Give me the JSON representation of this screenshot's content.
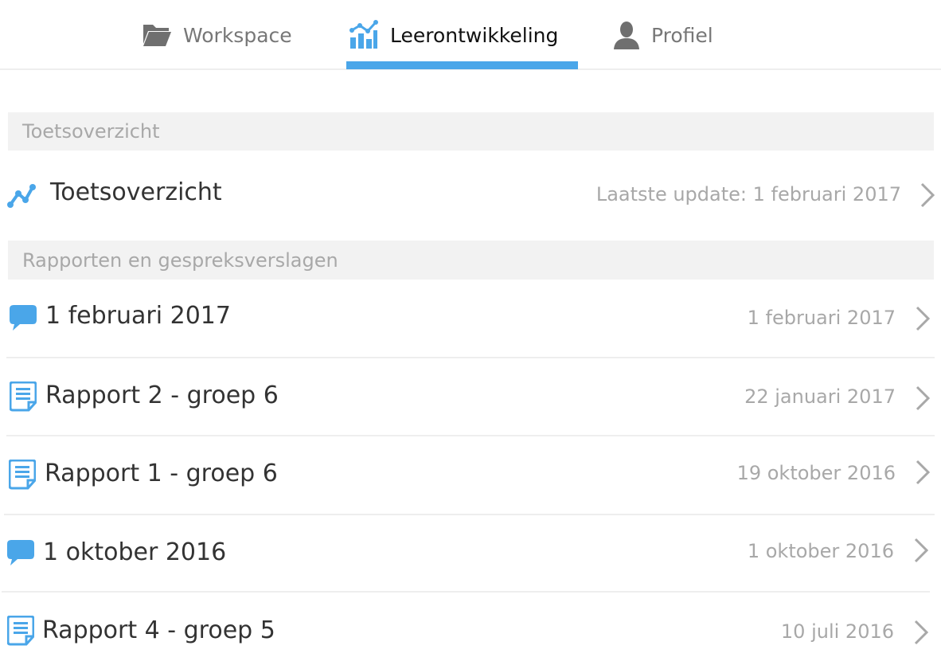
{
  "tabs": [
    {
      "label": "Workspace",
      "icon": "folder-icon",
      "active": false
    },
    {
      "label": "Leerontwikkeling",
      "icon": "chart-icon",
      "active": true
    },
    {
      "label": "Profiel",
      "icon": "user-icon",
      "active": false
    }
  ],
  "sections": [
    {
      "header": "Toetsoverzicht",
      "items": [
        {
          "title": "Toetsoverzicht",
          "date": "Laatste update: 1 februari 2017",
          "icon": "line-chart-icon"
        }
      ]
    },
    {
      "header": "Rapporten en gespreksverslagen",
      "items": [
        {
          "title": "1 februari 2017",
          "date": "1 februari 2017",
          "icon": "speech-bubble-icon"
        },
        {
          "title": "Rapport 2 -  groep 6",
          "date": "22 januari 2017",
          "icon": "document-icon"
        },
        {
          "title": "Rapport 1 -  groep 6",
          "date": "19 oktober 2016",
          "icon": "document-icon"
        },
        {
          "title": "1 oktober 2016",
          "date": "1 oktober 2016",
          "icon": "speech-bubble-icon"
        },
        {
          "title": "Rapport 4 -  groep 5",
          "date": "10 juli 2016",
          "icon": "document-icon"
        }
      ]
    }
  ],
  "colors": {
    "accent": "#4aa6e9",
    "muted": "#a8a8a8",
    "section_bg": "#f2f2f2"
  }
}
